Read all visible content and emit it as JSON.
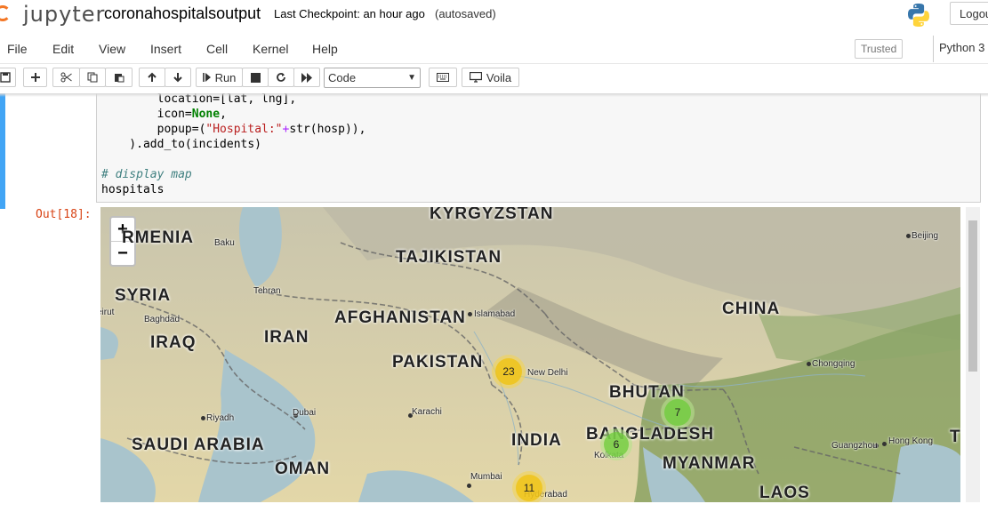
{
  "header": {
    "logo_text": "jupyter",
    "notebook_name": "coronahospitalsoutput",
    "checkpoint": "Last Checkpoint: an hour ago",
    "autosave": "(autosaved)",
    "logout_label": "Logout"
  },
  "menubar": {
    "items": [
      "File",
      "Edit",
      "View",
      "Insert",
      "Cell",
      "Kernel",
      "Help"
    ],
    "trusted": "Trusted",
    "kernel": "Python 3"
  },
  "toolbar": {
    "run_label": "Run",
    "cell_type": "Code",
    "voila_label": "Voila"
  },
  "cell": {
    "code_lines": [
      "        location=[lat, lng],",
      "        icon=None,",
      "        popup=(\"Hospital:\"+str(hosp)),",
      "    ).add_to(incidents)",
      "",
      "# display map",
      "hospitals"
    ],
    "out_prompt": "Out[18]:"
  },
  "map": {
    "zoom_in": "+",
    "zoom_out": "−",
    "countries": [
      "KYRGYZSTAN",
      "RMENIA",
      "TAJIKISTAN",
      "SYRIA",
      "AFGHANISTAN",
      "CHINA",
      "IRAQ",
      "IRAN",
      "PAKISTAN",
      "BHUTAN",
      "INDIA",
      "BANGLADESH",
      "SAUDI ARABIA",
      "OMAN",
      "MYANMAR",
      "LAOS",
      "T"
    ],
    "cities": [
      "Baku",
      "Beijing",
      "Tehran",
      "Islamabad",
      "eirut",
      "Baghdad",
      "New Delhi",
      "Chongqing",
      "Riyadh",
      "Dubai",
      "Karachi",
      "Kolkata",
      "Guangzhou",
      "Hong Kong",
      "Mumbai",
      "Hyderabad"
    ],
    "clusters": [
      {
        "count": "23",
        "color": "#f0c20c"
      },
      {
        "count": "7",
        "color": "#6ecc39"
      },
      {
        "count": "6",
        "color": "#6ecc39"
      },
      {
        "count": "11",
        "color": "#f0c20c"
      }
    ]
  },
  "colors": {
    "accent": "#42a5f5",
    "prompt_out": "#d84315",
    "jupyter_orange": "#f37726"
  }
}
